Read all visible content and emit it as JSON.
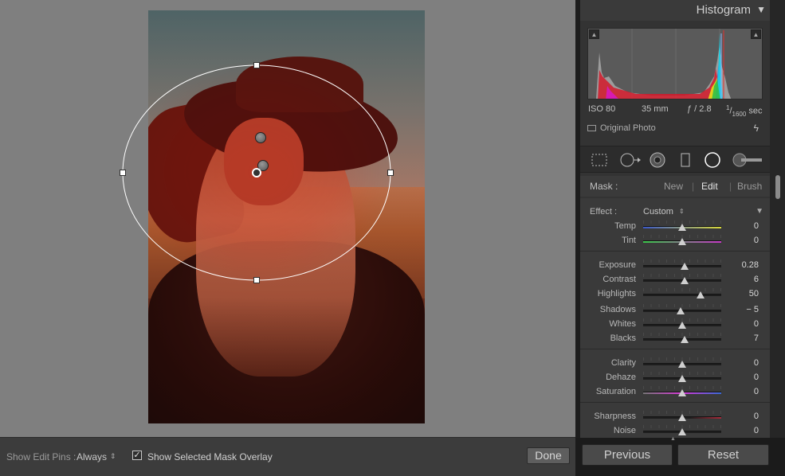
{
  "histogram": {
    "title": "Histogram",
    "iso": "ISO 80",
    "focal": "35 mm",
    "aperture": "ƒ / 2.8",
    "shutter_num": "1",
    "shutter_den": "1600",
    "shutter_unit": "sec",
    "original_photo": "Original Photo"
  },
  "mask": {
    "label": "Mask :",
    "new": "New",
    "edit": "Edit",
    "brush": "Brush"
  },
  "effect": {
    "label": "Effect :",
    "value": "Custom"
  },
  "sliders": [
    {
      "label": "Temp",
      "value": "0",
      "pos": 0.5,
      "gradient": "temp"
    },
    {
      "label": "Tint",
      "value": "0",
      "pos": 0.5,
      "gradient": "tint"
    },
    {
      "label": "Exposure",
      "value": "0.28",
      "pos": 0.53
    },
    {
      "label": "Contrast",
      "value": "6",
      "pos": 0.53
    },
    {
      "label": "Highlights",
      "value": "50",
      "pos": 0.73
    },
    {
      "label": "Shadows",
      "value": "− 5",
      "pos": 0.48
    },
    {
      "label": "Whites",
      "value": "0",
      "pos": 0.5
    },
    {
      "label": "Blacks",
      "value": "7",
      "pos": 0.53
    },
    {
      "label": "Clarity",
      "value": "0",
      "pos": 0.5
    },
    {
      "label": "Dehaze",
      "value": "0",
      "pos": 0.5
    },
    {
      "label": "Saturation",
      "value": "0",
      "pos": 0.5,
      "gradient": "sat"
    },
    {
      "label": "Sharpness",
      "value": "0",
      "pos": 0.5,
      "gradient": "sharp"
    },
    {
      "label": "Noise",
      "value": "0",
      "pos": 0.5
    }
  ],
  "toolbar": {
    "pins_label": "Show Edit Pins :",
    "pins_value": "Always",
    "overlay_checked": true,
    "overlay_label": "Show Selected Mask Overlay",
    "done": "Done"
  },
  "nav": {
    "previous": "Previous",
    "reset": "Reset"
  },
  "colors": {
    "panel_bg": "#3a3a3a",
    "canvas_bg": "#7f7f7f",
    "mask_overlay": "#dc2814"
  }
}
